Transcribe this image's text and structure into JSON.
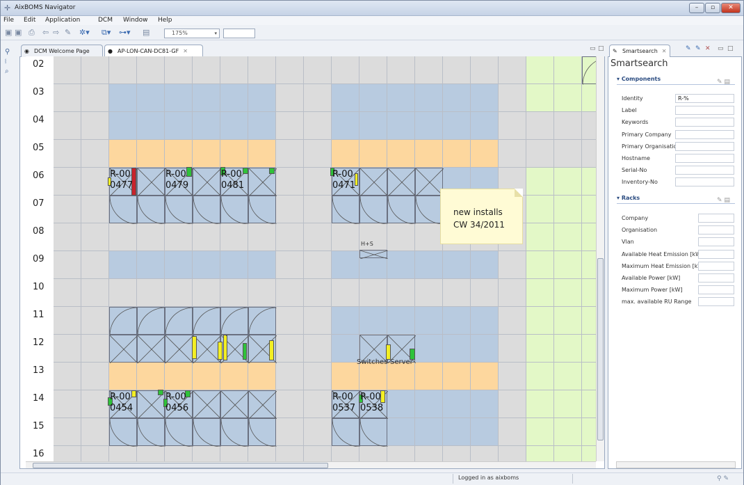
{
  "window": {
    "title": "AixBOMS Navigator"
  },
  "menu": [
    "File",
    "Edit",
    "Application",
    "DCM",
    "Window",
    "Help"
  ],
  "toolbar": {
    "zoom": "175%"
  },
  "editor_tabs": [
    {
      "label": "DCM Welcome Page",
      "active": false
    },
    {
      "label": "AP-LON-CAN-DC81-GF",
      "active": true
    }
  ],
  "floor": {
    "row_labels": [
      "02",
      "03",
      "04",
      "05",
      "06",
      "07",
      "08",
      "09",
      "10",
      "11",
      "12",
      "13",
      "14",
      "15",
      "16"
    ],
    "racks": [
      {
        "label": "R-00\n0477"
      },
      {
        "label": "R-00\n0479"
      },
      {
        "label": "R-00\n0481"
      },
      {
        "label": "R-00\n0471"
      },
      {
        "label": "R-00\n0454"
      },
      {
        "label": "R-00\n0456"
      },
      {
        "label": "R-00\n0537"
      },
      {
        "label": "R-00\n0538"
      }
    ],
    "note": {
      "line1": "new installs",
      "line2": "CW 34/2011"
    },
    "hs_label": "H+S",
    "switches_label": "Switches",
    "server_label": "Server"
  },
  "smartsearch": {
    "tab": "Smartsearch",
    "title": "Smartsearch",
    "components": {
      "heading": "Components",
      "fields": [
        {
          "label": "Identity",
          "value": "R-%"
        },
        {
          "label": "Label",
          "value": ""
        },
        {
          "label": "Keywords",
          "value": ""
        },
        {
          "label": "Primary Company",
          "value": ""
        },
        {
          "label": "Primary Organisation",
          "value": ""
        },
        {
          "label": "Hostname",
          "value": ""
        },
        {
          "label": "Serial-No",
          "value": ""
        },
        {
          "label": "Inventory-No",
          "value": ""
        }
      ]
    },
    "racks": {
      "heading": "Racks",
      "fields": [
        {
          "label": "Company",
          "value": ""
        },
        {
          "label": "Organisation",
          "value": ""
        },
        {
          "label": "Vlan",
          "value": ""
        },
        {
          "label": "Available Heat Emission [kW]",
          "value": ""
        },
        {
          "label": "Maximum Heat Emission [kW]",
          "value": ""
        },
        {
          "label": "Available Power [kW]",
          "value": ""
        },
        {
          "label": "Maximum Power [kW]",
          "value": ""
        },
        {
          "label": "max. available RU Range",
          "value": ""
        }
      ]
    }
  },
  "status": {
    "login": "Logged in as aixboms"
  },
  "colors": {
    "blue": "#b8cbe0",
    "orange": "#fdd79e",
    "green": "#e3f8c7",
    "grey": "#dcdcdc",
    "red": "#c8232c",
    "lime": "#2fc23a",
    "yellow": "#f3ef24"
  }
}
